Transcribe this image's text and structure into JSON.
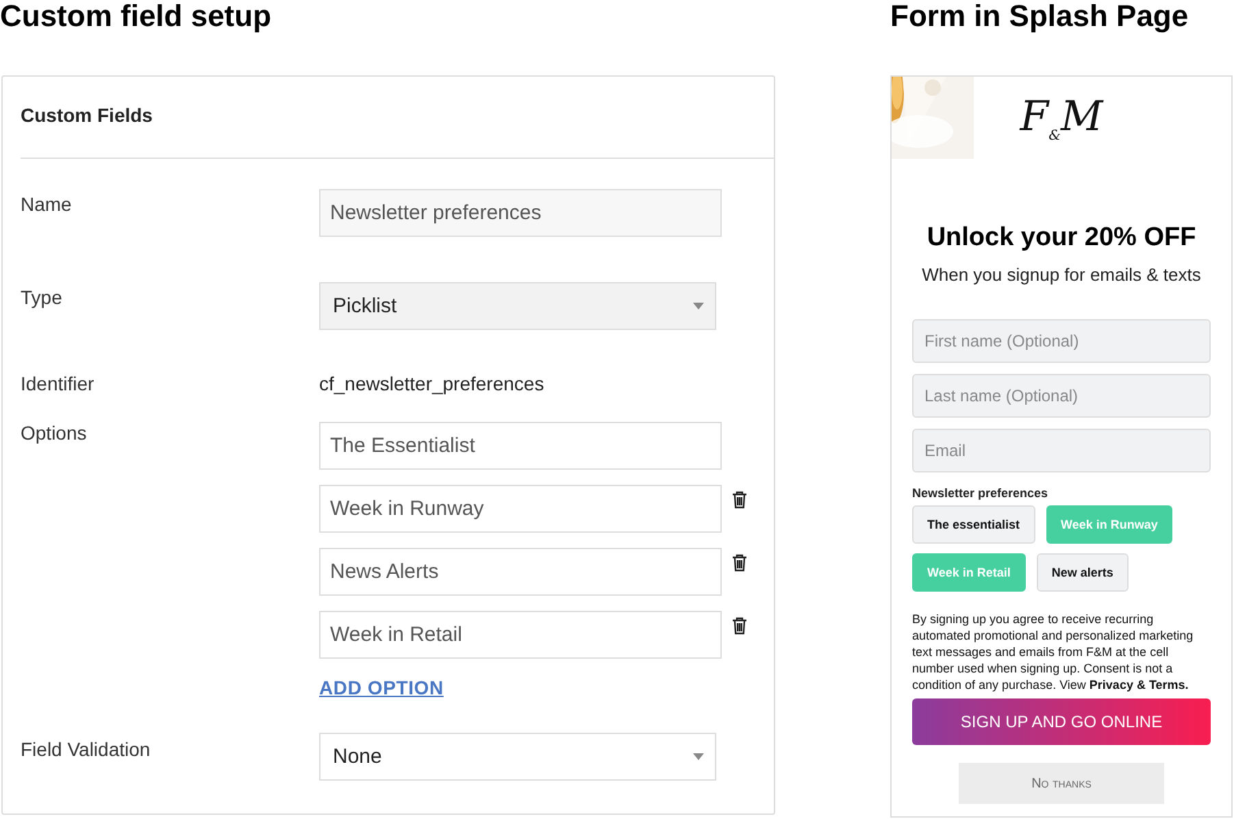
{
  "left": {
    "heading": "Custom field setup",
    "panel_title": "Custom Fields",
    "name": {
      "label": "Name",
      "value": "Newsletter preferences"
    },
    "type": {
      "label": "Type",
      "value": "Picklist"
    },
    "identifier": {
      "label": "Identifier",
      "value": "cf_newsletter_preferences"
    },
    "options": {
      "label": "Options",
      "items": [
        {
          "value": "The Essentialist",
          "removable": false
        },
        {
          "value": "Week in Runway",
          "removable": true
        },
        {
          "value": "News Alerts",
          "removable": true
        },
        {
          "value": "Week in Retail",
          "removable": true
        }
      ],
      "add_link": "ADD OPTION"
    },
    "validation": {
      "label": "Field Validation",
      "value": "None"
    }
  },
  "right": {
    "heading": "Form in Splash Page",
    "logo": "F$_{&}$M",
    "title": "Unlock your 20% OFF",
    "subtitle": "When you signup for emails & texts",
    "fields": [
      {
        "placeholder": "First name (Optional)"
      },
      {
        "placeholder": "Last name (Optional)"
      },
      {
        "placeholder": "Email"
      }
    ],
    "prefs_label": "Newsletter preferences",
    "chips": [
      {
        "label": "The essentialist",
        "selected": false
      },
      {
        "label": "Week in Runway",
        "selected": true
      },
      {
        "label": "Week in Retail",
        "selected": true
      },
      {
        "label": "New alerts",
        "selected": false
      }
    ],
    "consent": "By signing up you agree to receive recurring automated promotional and personalized marketing text messages and emails from F&M at the cell number used when signing up. Consent is not a condition of any purchase. View **Privacy & Terms.**",
    "submit": "SIGN UP AND GO ONLINE",
    "decline": "No thanks"
  }
}
